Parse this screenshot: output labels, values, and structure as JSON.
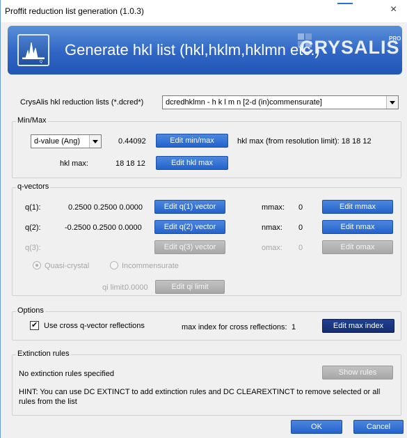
{
  "window": {
    "title": "Proffit reduction list generation (1.0.3)",
    "close_glyph": "×"
  },
  "banner": {
    "title": "Generate hkl list (hkl,hklm,hklmn etc.)",
    "logo": "CRYSALIS",
    "logo_sup": "PRO",
    "icon": "crysalis-app-icon"
  },
  "reduction": {
    "label": "CrysAlis hkl reduction lists (*.dcred*)",
    "selected": "dcredhklmn   - h k l m n [2-d (in)commensurate]"
  },
  "minmax": {
    "group_label": "Min/Max",
    "mode_selected": "d-value (Ang)",
    "value": "0.44092",
    "edit_minmax": "Edit min/max",
    "hkl_max_resolution": "hkl max (from resolution limit): 18 18 12",
    "hkl_max_label": "hkl max:",
    "hkl_max_value": "18 18 12",
    "edit_hkl_max": "Edit hkl max"
  },
  "qvectors": {
    "group_label": "q-vectors",
    "rows": [
      {
        "label": "q(1):",
        "value": "0.2500 0.2500 0.0000",
        "button": "Edit q(1) vector",
        "max_label": "mmax:",
        "max_value": "0",
        "max_button": "Edit mmax",
        "enabled": true
      },
      {
        "label": "q(2):",
        "value": "-0.2500 0.2500 0.0000",
        "button": "Edit q(2) vector",
        "max_label": "nmax:",
        "max_value": "0",
        "max_button": "Edit nmax",
        "enabled": true
      },
      {
        "label": "q(3):",
        "value": "",
        "button": "Edit q(3) vector",
        "max_label": "omax:",
        "max_value": "0",
        "max_button": "Edit omax",
        "enabled": false
      }
    ],
    "radio_quasi": "Quasi-crystal",
    "radio_incomm": "Incommensurate",
    "qi_limit_label": "qi limit:",
    "qi_limit_value": "0.0000",
    "edit_qi_limit": "Edit qi limit"
  },
  "options": {
    "group_label": "Options",
    "cross_checkbox": "Use cross q-vector reflections",
    "cross_checked": true,
    "max_index_label": "max index for cross reflections:",
    "max_index_value": "1",
    "edit_max_index": "Edit max index"
  },
  "extinction": {
    "group_label": "Extinction rules",
    "status": "No extinction rules specified",
    "show_rules": "Show rules",
    "hint_line1": "HINT: You can use DC EXTINCT to add extinction rules and DC CLEAREXTINCT to remove selected or all",
    "hint_line2": "rules from the list"
  },
  "footer": {
    "ok": "OK",
    "cancel": "Cancel"
  },
  "colors": {
    "button_blue": "#2462cc",
    "button_dark": "#142e70",
    "banner_blue": "#2f66c6",
    "disabled_grey": "#a7a7a7"
  }
}
